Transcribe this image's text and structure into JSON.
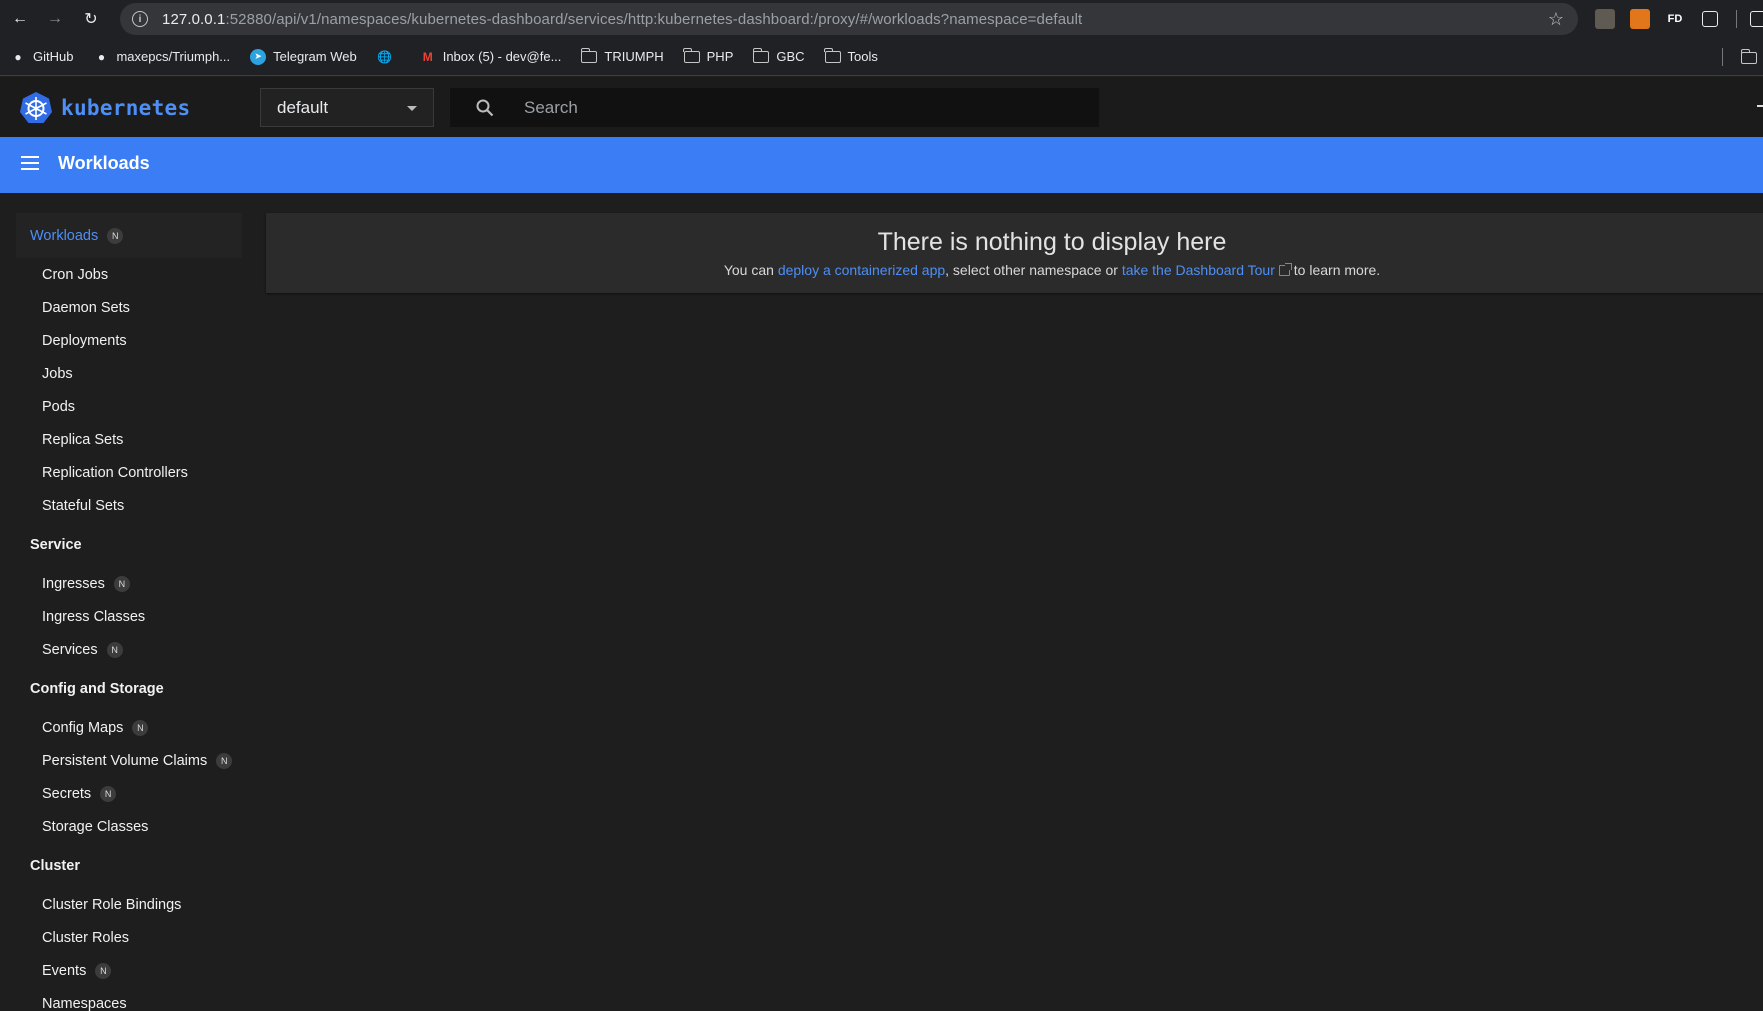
{
  "browser": {
    "url_host": "127.0.0.1",
    "url_rest": ":52880/api/v1/namespaces/kubernetes-dashboard/services/http:kubernetes-dashboard:/proxy/#/workloads?namespace=default",
    "extensions": [
      "FD"
    ],
    "bookmarks": [
      {
        "label": "GitHub",
        "icon": "github-icon"
      },
      {
        "label": "maxepcs/Triumph...",
        "icon": "github-icon"
      },
      {
        "label": "Telegram Web",
        "icon": "telegram-icon"
      },
      {
        "label": "",
        "icon": "globe-icon"
      },
      {
        "label": "Inbox (5) - dev@fe...",
        "icon": "gmail-icon"
      },
      {
        "label": "TRIUMPH",
        "icon": "folder-icon"
      },
      {
        "label": "PHP",
        "icon": "folder-icon"
      },
      {
        "label": "GBC",
        "icon": "folder-icon"
      },
      {
        "label": "Tools",
        "icon": "folder-icon"
      }
    ]
  },
  "appbar": {
    "brand": "kubernetes",
    "namespace": "default",
    "search_placeholder": "Search"
  },
  "titlebar": {
    "title": "Workloads"
  },
  "sidebar": {
    "workloads": {
      "label": "Workloads",
      "badge": "N"
    },
    "workload_items": [
      "Cron Jobs",
      "Daemon Sets",
      "Deployments",
      "Jobs",
      "Pods",
      "Replica Sets",
      "Replication Controllers",
      "Stateful Sets"
    ],
    "service": {
      "label": "Service"
    },
    "service_items": [
      {
        "label": "Ingresses",
        "badge": "N"
      },
      {
        "label": "Ingress Classes",
        "badge": ""
      },
      {
        "label": "Services",
        "badge": "N"
      }
    ],
    "config": {
      "label": "Config and Storage"
    },
    "config_items": [
      {
        "label": "Config Maps",
        "badge": "N"
      },
      {
        "label": "Persistent Volume Claims",
        "badge": "N"
      },
      {
        "label": "Secrets",
        "badge": "N"
      },
      {
        "label": "Storage Classes",
        "badge": ""
      }
    ],
    "cluster": {
      "label": "Cluster"
    },
    "cluster_items": [
      {
        "label": "Cluster Role Bindings",
        "badge": ""
      },
      {
        "label": "Cluster Roles",
        "badge": ""
      },
      {
        "label": "Events",
        "badge": "N"
      },
      {
        "label": "Namespaces",
        "badge": ""
      }
    ]
  },
  "empty_state": {
    "heading": "There is nothing to display here",
    "prefix": "You can ",
    "link1": "deploy a containerized app",
    "middle": ", select other namespace or ",
    "link2": "take the Dashboard Tour",
    "suffix": " to learn more."
  },
  "colors": {
    "accent": "#3a7df5",
    "link": "#4e8ff5",
    "background": "#1e1e1e"
  }
}
